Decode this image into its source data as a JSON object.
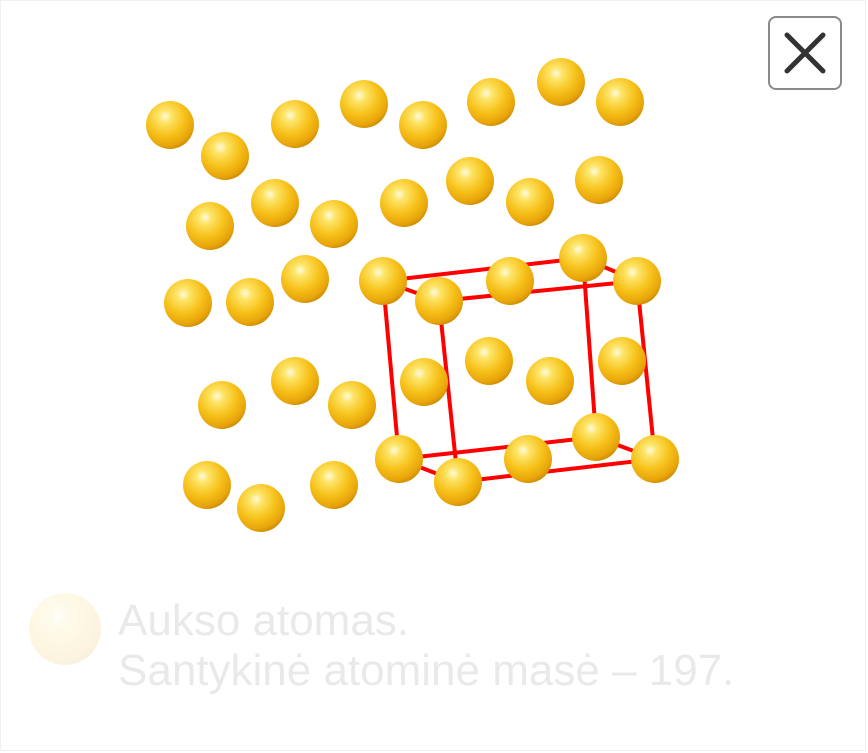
{
  "legend": {
    "line1": "Aukso atomas.",
    "line2": "Santykinė atominė masė – 197."
  },
  "icons": {
    "close": "close-icon",
    "atom": "gold-atom-icon"
  },
  "colors": {
    "atom_highlight": "#fffbe0",
    "atom_main": "#f7c21b",
    "atom_shadow": "#d38f00",
    "cell_edges": "#ff0000",
    "close_border": "#8a8a8a",
    "legend_text": "#555555"
  }
}
